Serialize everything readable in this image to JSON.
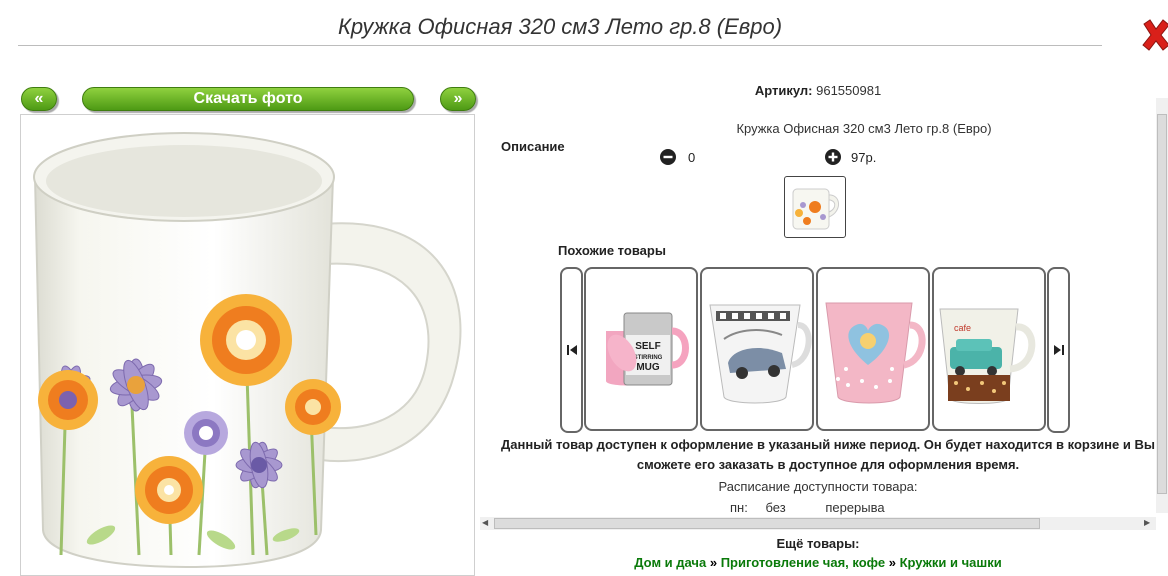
{
  "header": {
    "title": "Кружка Офисная 320 см3 Лето гр.8 (Евро)",
    "close_icon": "close-icon"
  },
  "photo_nav": {
    "prev_label": "«",
    "download_label": "Скачать фото",
    "next_label": "»"
  },
  "product": {
    "sku_label": "Артикул:",
    "sku_value": "961550981",
    "description_label": "Описание",
    "description_text": "Кружка Офисная 320 см3 Лето гр.8 (Евро)",
    "quantity": "0",
    "price": "97р."
  },
  "similar": {
    "title": "Похожие товары",
    "items": [
      {
        "kind": "self-stirring-mug",
        "label": "SELF STIRRING MUG"
      },
      {
        "kind": "car-mug"
      },
      {
        "kind": "heart-mug"
      },
      {
        "kind": "retro-car-mug"
      }
    ]
  },
  "availability": {
    "notice": "Данный товар доступен к оформление в указаный ниже период. Он будет находится в корзине и Вы сможете его заказать в доступное для оформления время.",
    "schedule_title": "Расписание доступности товара:",
    "day": "пн:",
    "mode": "без",
    "break": "перерыва"
  },
  "footer": {
    "more_label": "Ещё товары:",
    "crumbs": [
      "Дом и дача",
      "Приготовление чая, кофе",
      "Кружки и чашки"
    ],
    "separator": "»"
  },
  "colors": {
    "accent_green": "#5aa81b",
    "link_green": "#0a7a0a",
    "close_red": "#d9201a"
  }
}
